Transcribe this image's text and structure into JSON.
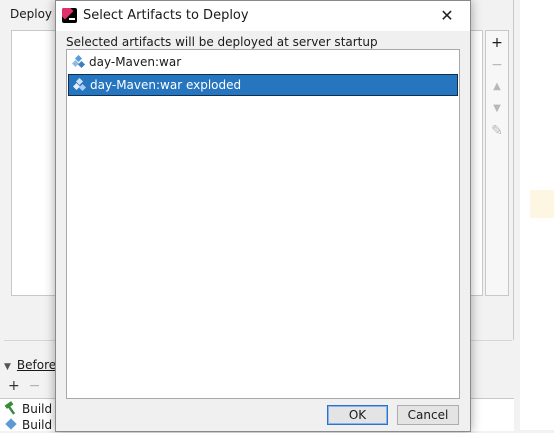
{
  "background_window": {
    "deploy_label": "Deploy a",
    "toolbar": {
      "add": "+",
      "remove": "−",
      "up": "▲",
      "down": "▼",
      "edit": "✎"
    },
    "before_section": {
      "label": "Before",
      "add": "+",
      "remove": "−"
    },
    "before_items": [
      "Build",
      "Build A"
    ]
  },
  "dialog": {
    "title": "Select Artifacts to Deploy",
    "close_glyph": "✕",
    "label": "Selected artifacts will be deployed at server startup",
    "artifacts": [
      {
        "name": "day-Maven:war",
        "selected": false,
        "icon": "artifact-icon"
      },
      {
        "name": "day-Maven:war exploded",
        "selected": true,
        "icon": "artifact-icon"
      }
    ],
    "ok_label": "OK",
    "cancel_label": "Cancel"
  },
  "colors": {
    "selection": "#2675bf",
    "artifact_icon": "#5b9bd5",
    "build_icon": "#3a8a3a"
  }
}
